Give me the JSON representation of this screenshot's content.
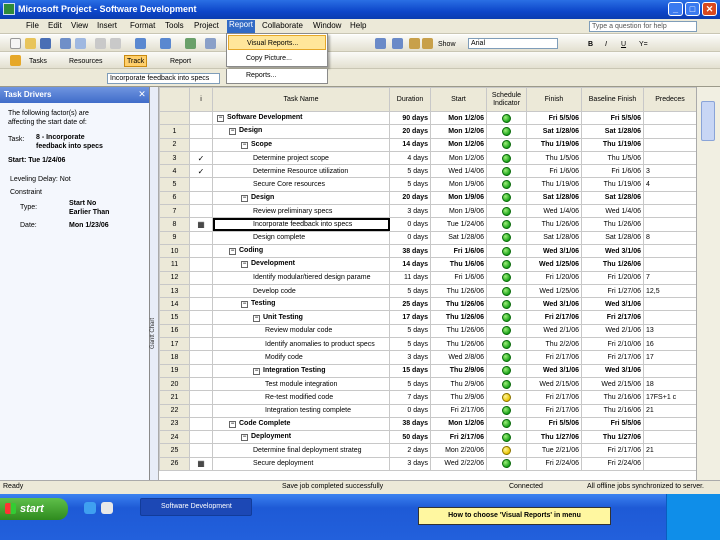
{
  "window": {
    "title": "Microsoft Project - Software Development"
  },
  "menu": [
    "File",
    "Edit",
    "View",
    "Insert",
    "Format",
    "Tools",
    "Project",
    "Report",
    "Collaborate",
    "Window",
    "Help"
  ],
  "ask": "Type a question for help",
  "toolbar": {
    "show": "Show",
    "font": "Arial",
    "bold": "B",
    "italic": "I",
    "underline": "U",
    "filter": "Y="
  },
  "guide": {
    "tasks": "Tasks",
    "resources": "Resources",
    "track": "Track",
    "report": "Report"
  },
  "dropdown": [
    "Visual Reports...",
    "Copy Picture...",
    "Reports..."
  ],
  "entry": "Incorporate feedback into specs",
  "pane": {
    "title": "Task Drivers",
    "intro": [
      "The following factor(s) are",
      "affecting the start date of:"
    ],
    "task_label": "Task:",
    "task_name": [
      "8 - Incorporate",
      "feedback into specs"
    ],
    "start": "Start: Tue 1/24/06",
    "leveling": "Leveling Delay: Not",
    "constraint": "Constraint",
    "type_label": "Type:",
    "type_value": [
      "Start No",
      "Earlier Than"
    ],
    "date_label": "Date:",
    "date_value": "Mon 1/23/06"
  },
  "side_label": "Gantt Chart",
  "columns": [
    "",
    "i",
    "Task Name",
    "Duration",
    "Start",
    "Schedule Indicator",
    "Finish",
    "Baseline Finish",
    "Predeces"
  ],
  "rows": [
    {
      "id": "",
      "ind": "",
      "name": "Software Development",
      "dur": "90 days",
      "start": "Mon 1/2/06",
      "dot": "g",
      "finish": "Fri 5/5/06",
      "base": "Fri 5/5/06",
      "pred": "",
      "lvl": 0,
      "sum": true
    },
    {
      "id": "1",
      "ind": "",
      "name": "Design",
      "dur": "20 days",
      "start": "Mon 1/2/06",
      "dot": "g",
      "finish": "Sat 1/28/06",
      "base": "Sat 1/28/06",
      "pred": "",
      "lvl": 1,
      "sum": true
    },
    {
      "id": "2",
      "ind": "",
      "name": "Scope",
      "dur": "14 days",
      "start": "Mon 1/2/06",
      "dot": "g",
      "finish": "Thu 1/19/06",
      "base": "Thu 1/19/06",
      "pred": "",
      "lvl": 2,
      "sum": true
    },
    {
      "id": "3",
      "ind": "✓",
      "name": "Determine project scope",
      "dur": "4 days",
      "start": "Mon 1/2/06",
      "dot": "g",
      "finish": "Thu 1/5/06",
      "base": "Thu 1/5/06",
      "pred": "",
      "lvl": 3
    },
    {
      "id": "4",
      "ind": "✓",
      "name": "Determine Resource utilization",
      "dur": "5 days",
      "start": "Wed 1/4/06",
      "dot": "g",
      "finish": "Fri 1/6/06",
      "base": "Fri 1/6/06",
      "pred": "3",
      "lvl": 3
    },
    {
      "id": "5",
      "ind": "",
      "name": "Secure Core resources",
      "dur": "5 days",
      "start": "Mon 1/9/06",
      "dot": "g",
      "finish": "Thu 1/19/06",
      "base": "Thu 1/19/06",
      "pred": "4",
      "lvl": 3
    },
    {
      "id": "6",
      "ind": "",
      "name": "Design",
      "dur": "20 days",
      "start": "Mon 1/9/06",
      "dot": "g",
      "finish": "Sat 1/28/06",
      "base": "Sat 1/28/06",
      "pred": "",
      "lvl": 2,
      "sum": true
    },
    {
      "id": "7",
      "ind": "",
      "name": "Review preliminary specs",
      "dur": "3 days",
      "start": "Mon 1/9/06",
      "dot": "g",
      "finish": "Wed 1/4/06",
      "base": "Wed 1/4/06",
      "pred": "",
      "lvl": 3
    },
    {
      "id": "8",
      "ind": "▦",
      "name": "Incorporate feedback into specs",
      "dur": "0 days",
      "start": "Tue 1/24/06",
      "dot": "g",
      "finish": "Thu 1/26/06",
      "base": "Thu 1/26/06",
      "pred": "",
      "lvl": 3,
      "sel": true
    },
    {
      "id": "9",
      "ind": "",
      "name": "Design complete",
      "dur": "0 days",
      "start": "Sat 1/28/06",
      "dot": "g",
      "finish": "Sat 1/28/06",
      "base": "Sat 1/28/06",
      "pred": "8",
      "lvl": 3
    },
    {
      "id": "10",
      "ind": "",
      "name": "Coding",
      "dur": "38 days",
      "start": "Fri 1/6/06",
      "dot": "g",
      "finish": "Wed 3/1/06",
      "base": "Wed 3/1/06",
      "pred": "",
      "lvl": 1,
      "sum": true
    },
    {
      "id": "11",
      "ind": "",
      "name": "Development",
      "dur": "14 days",
      "start": "Thu 1/6/06",
      "dot": "g",
      "finish": "Wed 1/25/06",
      "base": "Thu 1/26/06",
      "pred": "",
      "lvl": 2,
      "sum": true
    },
    {
      "id": "12",
      "ind": "",
      "name": "Identify modular/tiered design parame",
      "dur": "11 days",
      "start": "Fri 1/6/06",
      "dot": "g",
      "finish": "Fri 1/20/06",
      "base": "Fri 1/20/06",
      "pred": "7",
      "lvl": 3
    },
    {
      "id": "13",
      "ind": "",
      "name": "Develop code",
      "dur": "5 days",
      "start": "Thu 1/26/06",
      "dot": "g",
      "finish": "Wed 1/25/06",
      "base": "Fri 1/27/06",
      "pred": "12,5",
      "lvl": 3
    },
    {
      "id": "14",
      "ind": "",
      "name": "Testing",
      "dur": "25 days",
      "start": "Thu 1/26/06",
      "dot": "g",
      "finish": "Wed 3/1/06",
      "base": "Wed 3/1/06",
      "pred": "",
      "lvl": 2,
      "sum": true
    },
    {
      "id": "15",
      "ind": "",
      "name": "Unit Testing",
      "dur": "17 days",
      "start": "Thu 1/26/06",
      "dot": "g",
      "finish": "Fri 2/17/06",
      "base": "Fri 2/17/06",
      "pred": "",
      "lvl": 3,
      "sum": true
    },
    {
      "id": "16",
      "ind": "",
      "name": "Review modular code",
      "dur": "5 days",
      "start": "Thu 1/26/06",
      "dot": "g",
      "finish": "Wed 2/1/06",
      "base": "Wed 2/1/06",
      "pred": "13",
      "lvl": 4
    },
    {
      "id": "17",
      "ind": "",
      "name": "Identify anomalies to product specs",
      "dur": "5 days",
      "start": "Thu 1/26/06",
      "dot": "g",
      "finish": "Thu 2/2/06",
      "base": "Fri 2/10/06",
      "pred": "16",
      "lvl": 4
    },
    {
      "id": "18",
      "ind": "",
      "name": "Modify code",
      "dur": "3 days",
      "start": "Wed 2/8/06",
      "dot": "g",
      "finish": "Fri 2/17/06",
      "base": "Fri 2/17/06",
      "pred": "17",
      "lvl": 4
    },
    {
      "id": "19",
      "ind": "",
      "name": "Integration Testing",
      "dur": "15 days",
      "start": "Thu 2/9/06",
      "dot": "g",
      "finish": "Wed 3/1/06",
      "base": "Wed 3/1/06",
      "pred": "",
      "lvl": 3,
      "sum": true
    },
    {
      "id": "20",
      "ind": "",
      "name": "Test module integration",
      "dur": "5 days",
      "start": "Thu 2/9/06",
      "dot": "g",
      "finish": "Wed 2/15/06",
      "base": "Wed 2/15/06",
      "pred": "18",
      "lvl": 4
    },
    {
      "id": "21",
      "ind": "",
      "name": "Re-test modified code",
      "dur": "7 days",
      "start": "Thu 2/9/06",
      "dot": "y",
      "finish": "Fri 2/17/06",
      "base": "Thu 2/16/06",
      "pred": "17FS+1 c",
      "lvl": 4
    },
    {
      "id": "22",
      "ind": "",
      "name": "Integration testing complete",
      "dur": "0 days",
      "start": "Fri 2/17/06",
      "dot": "g",
      "finish": "Fri 2/17/06",
      "base": "Thu 2/16/06",
      "pred": "21",
      "lvl": 4
    },
    {
      "id": "23",
      "ind": "",
      "name": "Code Complete",
      "dur": "38 days",
      "start": "Mon 1/2/06",
      "dot": "g",
      "finish": "Fri 5/5/06",
      "base": "Fri 5/5/06",
      "pred": "",
      "lvl": 1,
      "sum": true
    },
    {
      "id": "24",
      "ind": "",
      "name": "Deployment",
      "dur": "50 days",
      "start": "Fri 2/17/06",
      "dot": "g",
      "finish": "Thu 1/27/06",
      "base": "Thu 1/27/06",
      "pred": "",
      "lvl": 2,
      "sum": true
    },
    {
      "id": "25",
      "ind": "",
      "name": "Determine final deployment strateg",
      "dur": "2 days",
      "start": "Mon 2/20/06",
      "dot": "y",
      "finish": "Tue 2/21/06",
      "base": "Fri 2/17/06",
      "pred": "21",
      "lvl": 3
    },
    {
      "id": "26",
      "ind": "▦",
      "name": "Secure deployment",
      "dur": "3 days",
      "start": "Wed 2/22/06",
      "dot": "g",
      "finish": "Fri 2/24/06",
      "base": "Fri 2/24/06",
      "pred": "",
      "lvl": 3
    }
  ],
  "status": {
    "ready": "Ready",
    "saved": "Save job completed successfully",
    "connected": "Connected",
    "sync": "All offline jobs synchronized to server."
  },
  "taskbar": {
    "start": "start",
    "item": "Software Development",
    "caption": "How to choose 'Visual Reports' in menu"
  }
}
